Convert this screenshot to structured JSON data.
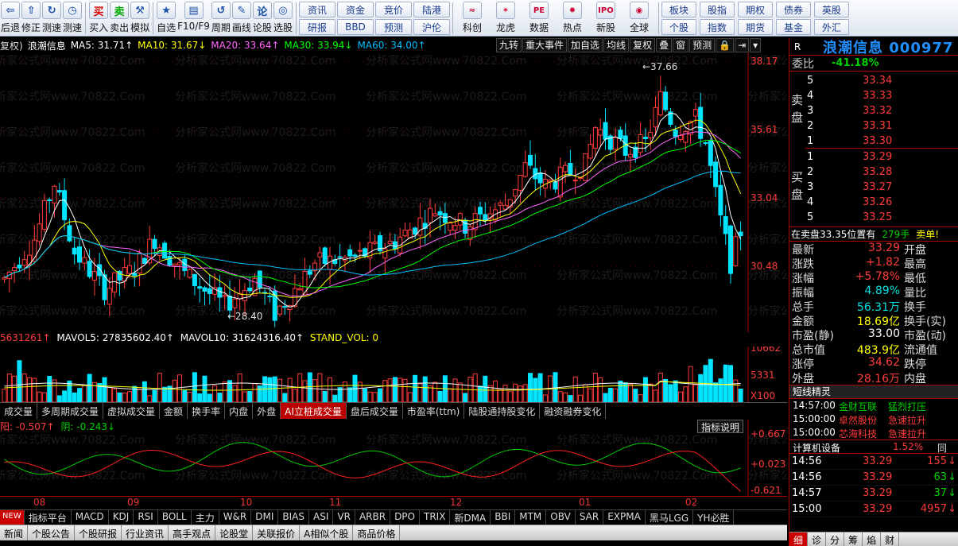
{
  "toolbar": {
    "buttons": [
      {
        "label": "后退",
        "icon": "back-arrow-icon",
        "glyph": "⇦"
      },
      {
        "label": "修正",
        "icon": "up-arrow-icon",
        "glyph": "⇧"
      },
      {
        "label": "测速",
        "icon": "refresh-icon",
        "glyph": "↻"
      },
      {
        "label": "测速",
        "icon": "clock-icon",
        "glyph": "◷"
      },
      {
        "label": "买入",
        "icon": "buy-icon",
        "glyph": "买"
      },
      {
        "label": "卖出",
        "icon": "sell-icon",
        "glyph": "卖"
      },
      {
        "label": "模拟",
        "icon": "hammer-icon",
        "glyph": "⚒"
      },
      {
        "label": "自选",
        "icon": "star-icon",
        "glyph": "★"
      },
      {
        "label": "F10/F9",
        "icon": "f10-icon",
        "glyph": "▤"
      },
      {
        "label": "周期",
        "icon": "cycle-icon",
        "glyph": "↺"
      },
      {
        "label": "画线",
        "icon": "pen-icon",
        "glyph": "✎"
      },
      {
        "label": "论股",
        "icon": "discuss-icon",
        "glyph": "论"
      },
      {
        "label": "选股",
        "icon": "select-icon",
        "glyph": "◎"
      }
    ],
    "grid1": [
      "资讯",
      "资金",
      "竞价",
      "陆港",
      "研报",
      "BBD",
      "预测",
      "沪伦"
    ],
    "icons2": [
      {
        "label": "科创",
        "glyph": "≈"
      },
      {
        "label": "龙虎",
        "glyph": "✶"
      },
      {
        "label": "数据",
        "glyph": "PE"
      },
      {
        "label": "热点",
        "glyph": "✹"
      },
      {
        "label": "新股",
        "glyph": "IPO"
      },
      {
        "label": "全球",
        "glyph": "◉"
      }
    ],
    "grid2": [
      "板块",
      "股指",
      "期权",
      "债券",
      "英股",
      "个股",
      "指数",
      "期货",
      "基金",
      "外汇"
    ]
  },
  "chart": {
    "rights": "复权)",
    "stock": "浪潮信息",
    "ma": [
      {
        "label": "MA5: 31.71↑",
        "color": "#ffffff"
      },
      {
        "label": "MA10: 31.67↓",
        "color": "#ffff00"
      },
      {
        "label": "MA20: 33.64↑",
        "color": "#ff66ff"
      },
      {
        "label": "MA30: 33.94↓",
        "color": "#00ff00"
      },
      {
        "label": "MA60: 34.00↑",
        "color": "#00bfff"
      }
    ],
    "tools": [
      "九转",
      "重大事件",
      "加自选",
      "均线",
      "复权",
      "叠",
      "窗",
      "预测",
      "🔒",
      "⇥",
      "▾"
    ],
    "price_ticks": [
      "38.17",
      "35.61",
      "33.04",
      "30.48"
    ],
    "high_label": "←37.66",
    "low_label": "←28.40",
    "watermark": "分析家公式网www.70822.Com",
    "vol_head": {
      "v1": "5631261↑",
      "v2": "MAVOL5: 27835602.40↑",
      "v3": "MAVOL10: 31624316.40↑",
      "v4": "STAND_VOL: 0"
    },
    "vol_ticks": [
      "10662",
      "5331",
      "X100"
    ],
    "mid_tabs": [
      "成交量",
      "多周期成交量",
      "虚拟成交量",
      "金额",
      "换手率",
      "内盘",
      "外盘",
      "AI立桩成交量",
      "盘后成交量",
      "市盈率(ttm)",
      "陆股通持股变化",
      "融资融券变化"
    ],
    "mid_active": 7,
    "ind_head": {
      "a": "阳: -0.507↑",
      "b": "阴: -0.243↓"
    },
    "ind_explain": "指标说明",
    "ind_ticks": [
      "+0.667",
      "+0.023",
      "-0.621"
    ],
    "dates": [
      "08",
      "09",
      "10",
      "11",
      "12",
      "01",
      "02"
    ],
    "ind_tabs": [
      "NEW",
      "指标平台",
      "MACD",
      "KDJ",
      "RSI",
      "BOLL",
      "主力",
      "W&R",
      "DMI",
      "BIAS",
      "ASI",
      "VR",
      "ARBR",
      "DPO",
      "TRIX",
      "新DMA",
      "BBI",
      "MTM",
      "OBV",
      "SAR",
      "EXPMA",
      "黑马LGG",
      "YH必胜"
    ],
    "bottom_tabs": [
      "新闻",
      "个股公告",
      "个股研报",
      "行业资讯",
      "高手观点",
      "论股堂",
      "关联报价",
      "A相似个股",
      "商品价格"
    ]
  },
  "panel": {
    "r": "R",
    "name": "浪潮信息 000977",
    "weibi_label": "委比",
    "weibi": "-41.18%",
    "sell_label": "卖盘",
    "buy_label": "买盘",
    "asks": [
      {
        "n": "5",
        "p": "33.34"
      },
      {
        "n": "4",
        "p": "33.33"
      },
      {
        "n": "3",
        "p": "33.32"
      },
      {
        "n": "2",
        "p": "33.31"
      },
      {
        "n": "1",
        "p": "33.30"
      }
    ],
    "bids": [
      {
        "n": "1",
        "p": "33.29"
      },
      {
        "n": "2",
        "p": "33.28"
      },
      {
        "n": "3",
        "p": "33.27"
      },
      {
        "n": "4",
        "p": "33.26"
      },
      {
        "n": "5",
        "p": "33.25"
      }
    ],
    "notice_a": "在卖盘33.35位置有",
    "notice_b": "279手",
    "notice_c": "卖单!",
    "quotes": [
      {
        "a": "最新",
        "b": "33.29",
        "bc": "red",
        "c": "开盘"
      },
      {
        "a": "涨跌",
        "b": "+1.82",
        "bc": "red",
        "c": "最高"
      },
      {
        "a": "涨幅",
        "b": "+5.78%",
        "bc": "red",
        "c": "最低"
      },
      {
        "a": "振幅",
        "b": "4.89%",
        "bc": "cy",
        "c": "量比"
      },
      {
        "a": "总手",
        "b": "56.31万",
        "bc": "cy",
        "c": "换手"
      },
      {
        "a": "金额",
        "b": "18.69亿",
        "bc": "yel",
        "c": "换手(实)"
      },
      {
        "a": "市盈(静)",
        "b": "33.00",
        "bc": "wht",
        "c": "市盈(动)"
      },
      {
        "a": "总市值",
        "b": "483.9亿",
        "bc": "yel",
        "c": "流通值"
      },
      {
        "a": "涨停",
        "b": "34.62",
        "bc": "red",
        "c": "跌停"
      },
      {
        "a": "外盘",
        "b": "28.16万",
        "bc": "red",
        "c": "内盘"
      }
    ],
    "short_head": "短线精灵",
    "short": [
      {
        "t": "14:57:00",
        "s": "金财互联",
        "e": "猛烈打压",
        "sc": "grn",
        "ec": "grn"
      },
      {
        "t": "15:00:00",
        "s": "卓然股份",
        "e": "急速拉升",
        "sc": "red",
        "ec": "red"
      },
      {
        "t": "15:00:00",
        "s": "芯海科技",
        "e": "急速拉升",
        "sc": "red",
        "ec": "red"
      }
    ],
    "sector_name": "计算机设备",
    "sector_pct": "1.52%",
    "sector_more": "同",
    "ticks": [
      {
        "t": "14:56",
        "p": "33.29",
        "v": "155",
        "d": "↓",
        "vc": "red"
      },
      {
        "t": "14:56",
        "p": "33.29",
        "v": "63",
        "d": "↓",
        "vc": "grn"
      },
      {
        "t": "14:57",
        "p": "33.29",
        "v": "37",
        "d": "↓",
        "vc": "grn"
      },
      {
        "t": "15:00",
        "p": "33.29",
        "v": "4957",
        "d": "↓",
        "vc": "red"
      }
    ],
    "tabs": [
      "细",
      "诊",
      "分",
      "筹",
      "焰",
      "财"
    ]
  }
}
